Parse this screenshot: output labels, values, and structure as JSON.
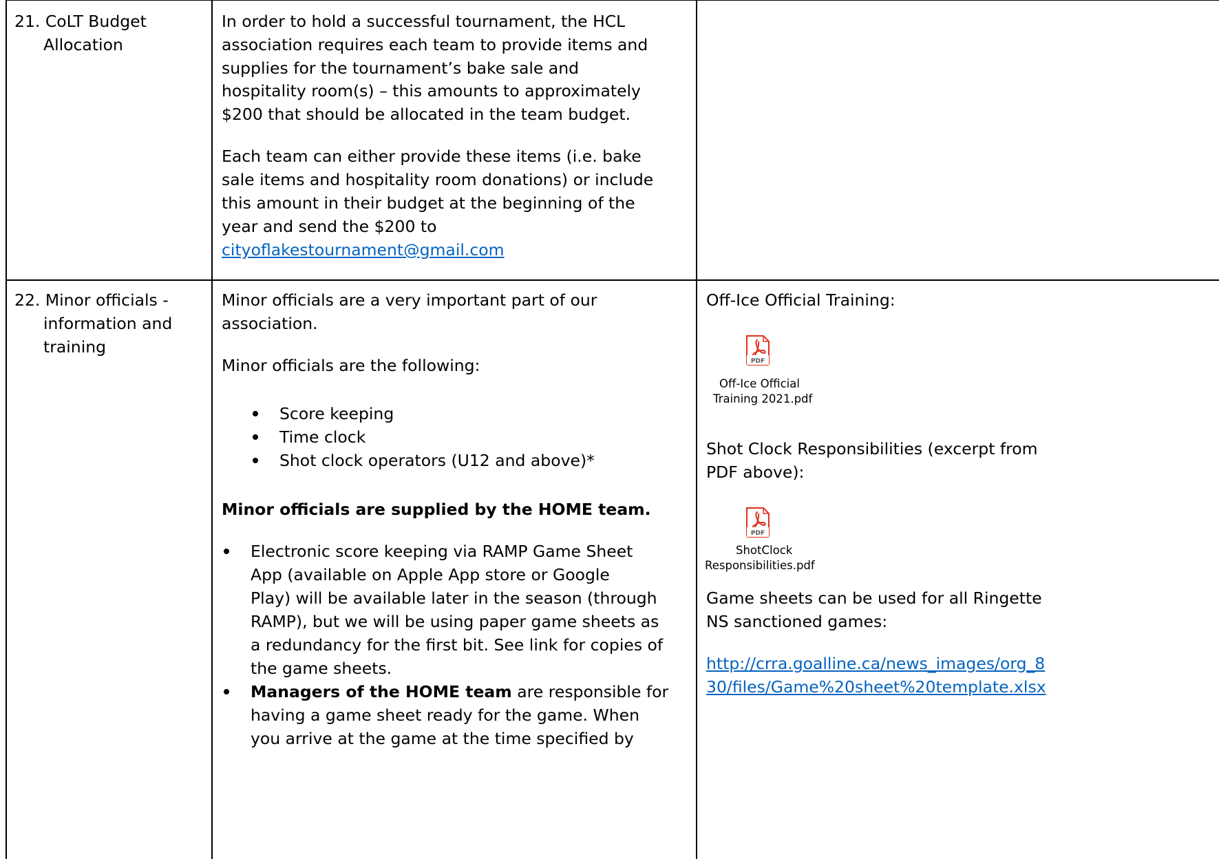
{
  "rows": [
    {
      "topic_lines": [
        "21. CoLT Budget",
        "Allocation"
      ],
      "para1_lines": [
        "In order to hold a successful tournament, the HCL",
        "association requires each team to provide items and",
        "supplies for the tournament’s bake sale and",
        "hospitality room(s) – this amounts to approximately",
        "$200 that should be allocated in the team budget."
      ],
      "para2_lines": [
        "Each team can either provide these items (i.e. bake",
        "sale items and hospitality room donations) or include",
        "this amount in their budget at the beginning of the",
        "year and send the $200 to"
      ],
      "email": "cityoflakestournament@gmail.com"
    },
    {
      "topic_lines": [
        "22. Minor officials -",
        "information and",
        "training"
      ],
      "intro_lines": [
        "Minor officials are a very important part of our",
        "association."
      ],
      "list_intro": "Minor officials are the following:",
      "roles": [
        "Score keeping",
        "Time clock",
        "Shot clock operators (U12 and above)*"
      ],
      "home_note": "Minor officials are supplied by the HOME team.",
      "bullet1_lines": [
        "Electronic score keeping via RAMP Game Sheet",
        "App (available on Apple App store or Google",
        "Play) will be available later in the season (through",
        "RAMP), but we will be using paper game sheets as",
        "a redundancy for the first bit. See link for copies of",
        "the game sheets."
      ],
      "bullet2_bold": "Managers of the HOME team",
      "bullet2_rest": " are responsible for",
      "bullet2_lines": [
        "having a game sheet ready for the game. When",
        "you arrive at the game at the time specified by"
      ],
      "resources": {
        "training_title": "Off-Ice Official Training:",
        "training_file_lines": [
          "Off-Ice Official",
          "Training 2021.pdf"
        ],
        "shot_title_lines": [
          "Shot Clock Responsibilities (excerpt from",
          "PDF above):"
        ],
        "shot_file_lines": [
          "ShotClock",
          "Responsibilities.pdf"
        ],
        "gamesheet_lines": [
          "Game sheets can be used for all Ringette",
          "NS sanctioned games:"
        ],
        "link_lines": [
          "http://crra.goalline.ca/news_images/org_8",
          "30/files/Game%20sheet%20template.xlsx"
        ],
        "pdf_label": "PDF"
      }
    }
  ],
  "colors": {
    "link": "#0563c1",
    "pdf_red": "#e0301e",
    "border": "#000000"
  }
}
